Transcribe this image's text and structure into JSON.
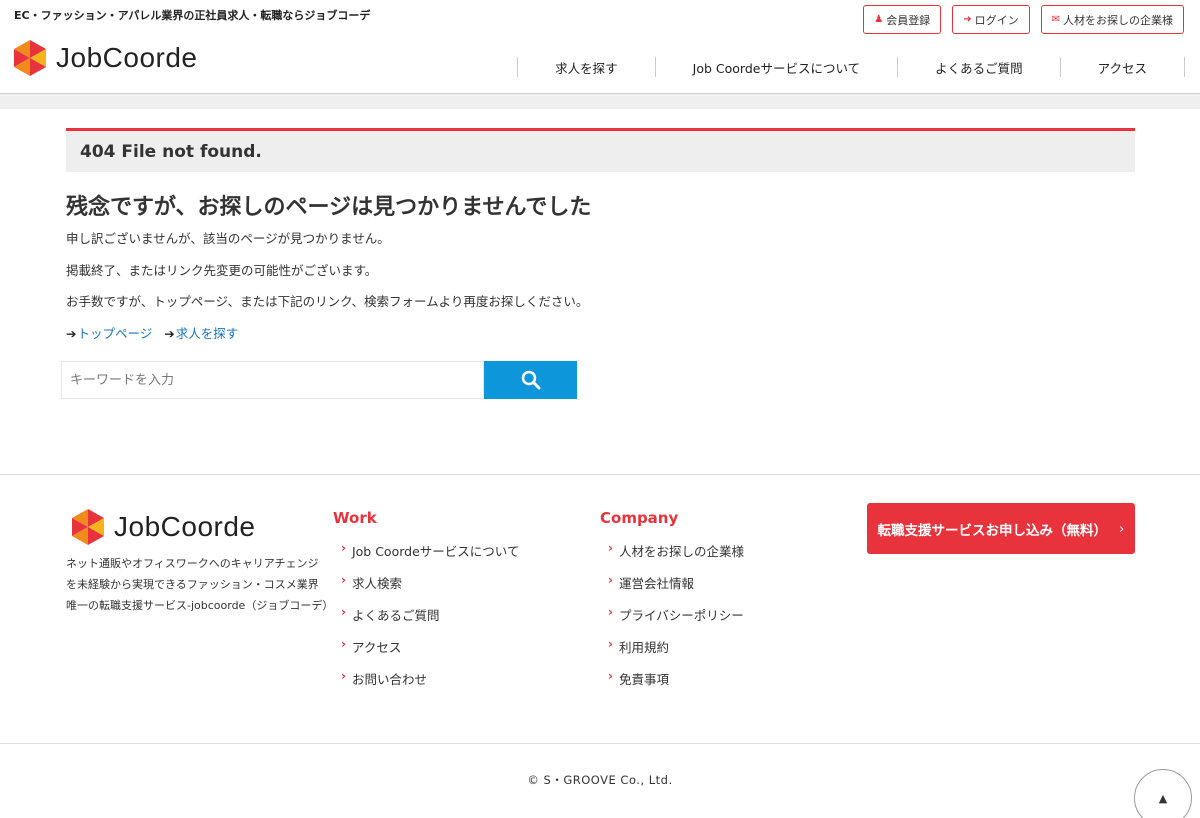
{
  "header": {
    "tagline": "EC・ファッション・アパレル業界の正社員求人・転職ならジョブコーデ",
    "logo_text": "JobCoorde",
    "top_buttons": [
      {
        "label": "会員登録",
        "icon": "user-plus-icon"
      },
      {
        "label": "ログイン",
        "icon": "sign-in-icon"
      },
      {
        "label": "人材をお探しの企業様",
        "icon": "envelope-icon"
      }
    ],
    "nav": [
      "求人を探す",
      "Job Coordeサービスについて",
      "よくあるご質問",
      "アクセス"
    ]
  },
  "main": {
    "error_heading": "404 File not found.",
    "title": "残念ですが、お探しのページは見つかりませんでした",
    "paragraphs": [
      "申し訳ございませんが、該当のページが見つかりません。",
      "掲載終了、またはリンク先変更の可能性がございます。",
      "お手数ですが、トップページ、または下記のリンク、検索フォームより再度お探しください。"
    ],
    "links": [
      "トップページ",
      "求人を探す"
    ],
    "search": {
      "placeholder": "キーワードを入力",
      "value": ""
    }
  },
  "footer": {
    "logo_text": "JobCoorde",
    "description": "ネット通販やオフィスワークへのキャリアチェンジを未経験から実現できるファッション・コスメ業界唯一の転職支援サービス-jobcoorde（ジョブコーデ）",
    "work": {
      "heading": "Work",
      "items": [
        "Job Coordeサービスについて",
        "求人検索",
        "よくあるご質問",
        "アクセス",
        "お問い合わせ"
      ]
    },
    "company": {
      "heading": "Company",
      "items": [
        "人材をお探しの企業様",
        "運営会社情報",
        "プライバシーポリシー",
        "利用規約",
        "免責事項"
      ]
    },
    "cta": "転職支援サービスお申し込み（無料）",
    "copyright": "© S・GROOVE Co., Ltd.",
    "to_top": "▲"
  },
  "colors": {
    "accent": "#e8333c",
    "search_button": "#0d96d9",
    "link": "#1a73c6"
  }
}
